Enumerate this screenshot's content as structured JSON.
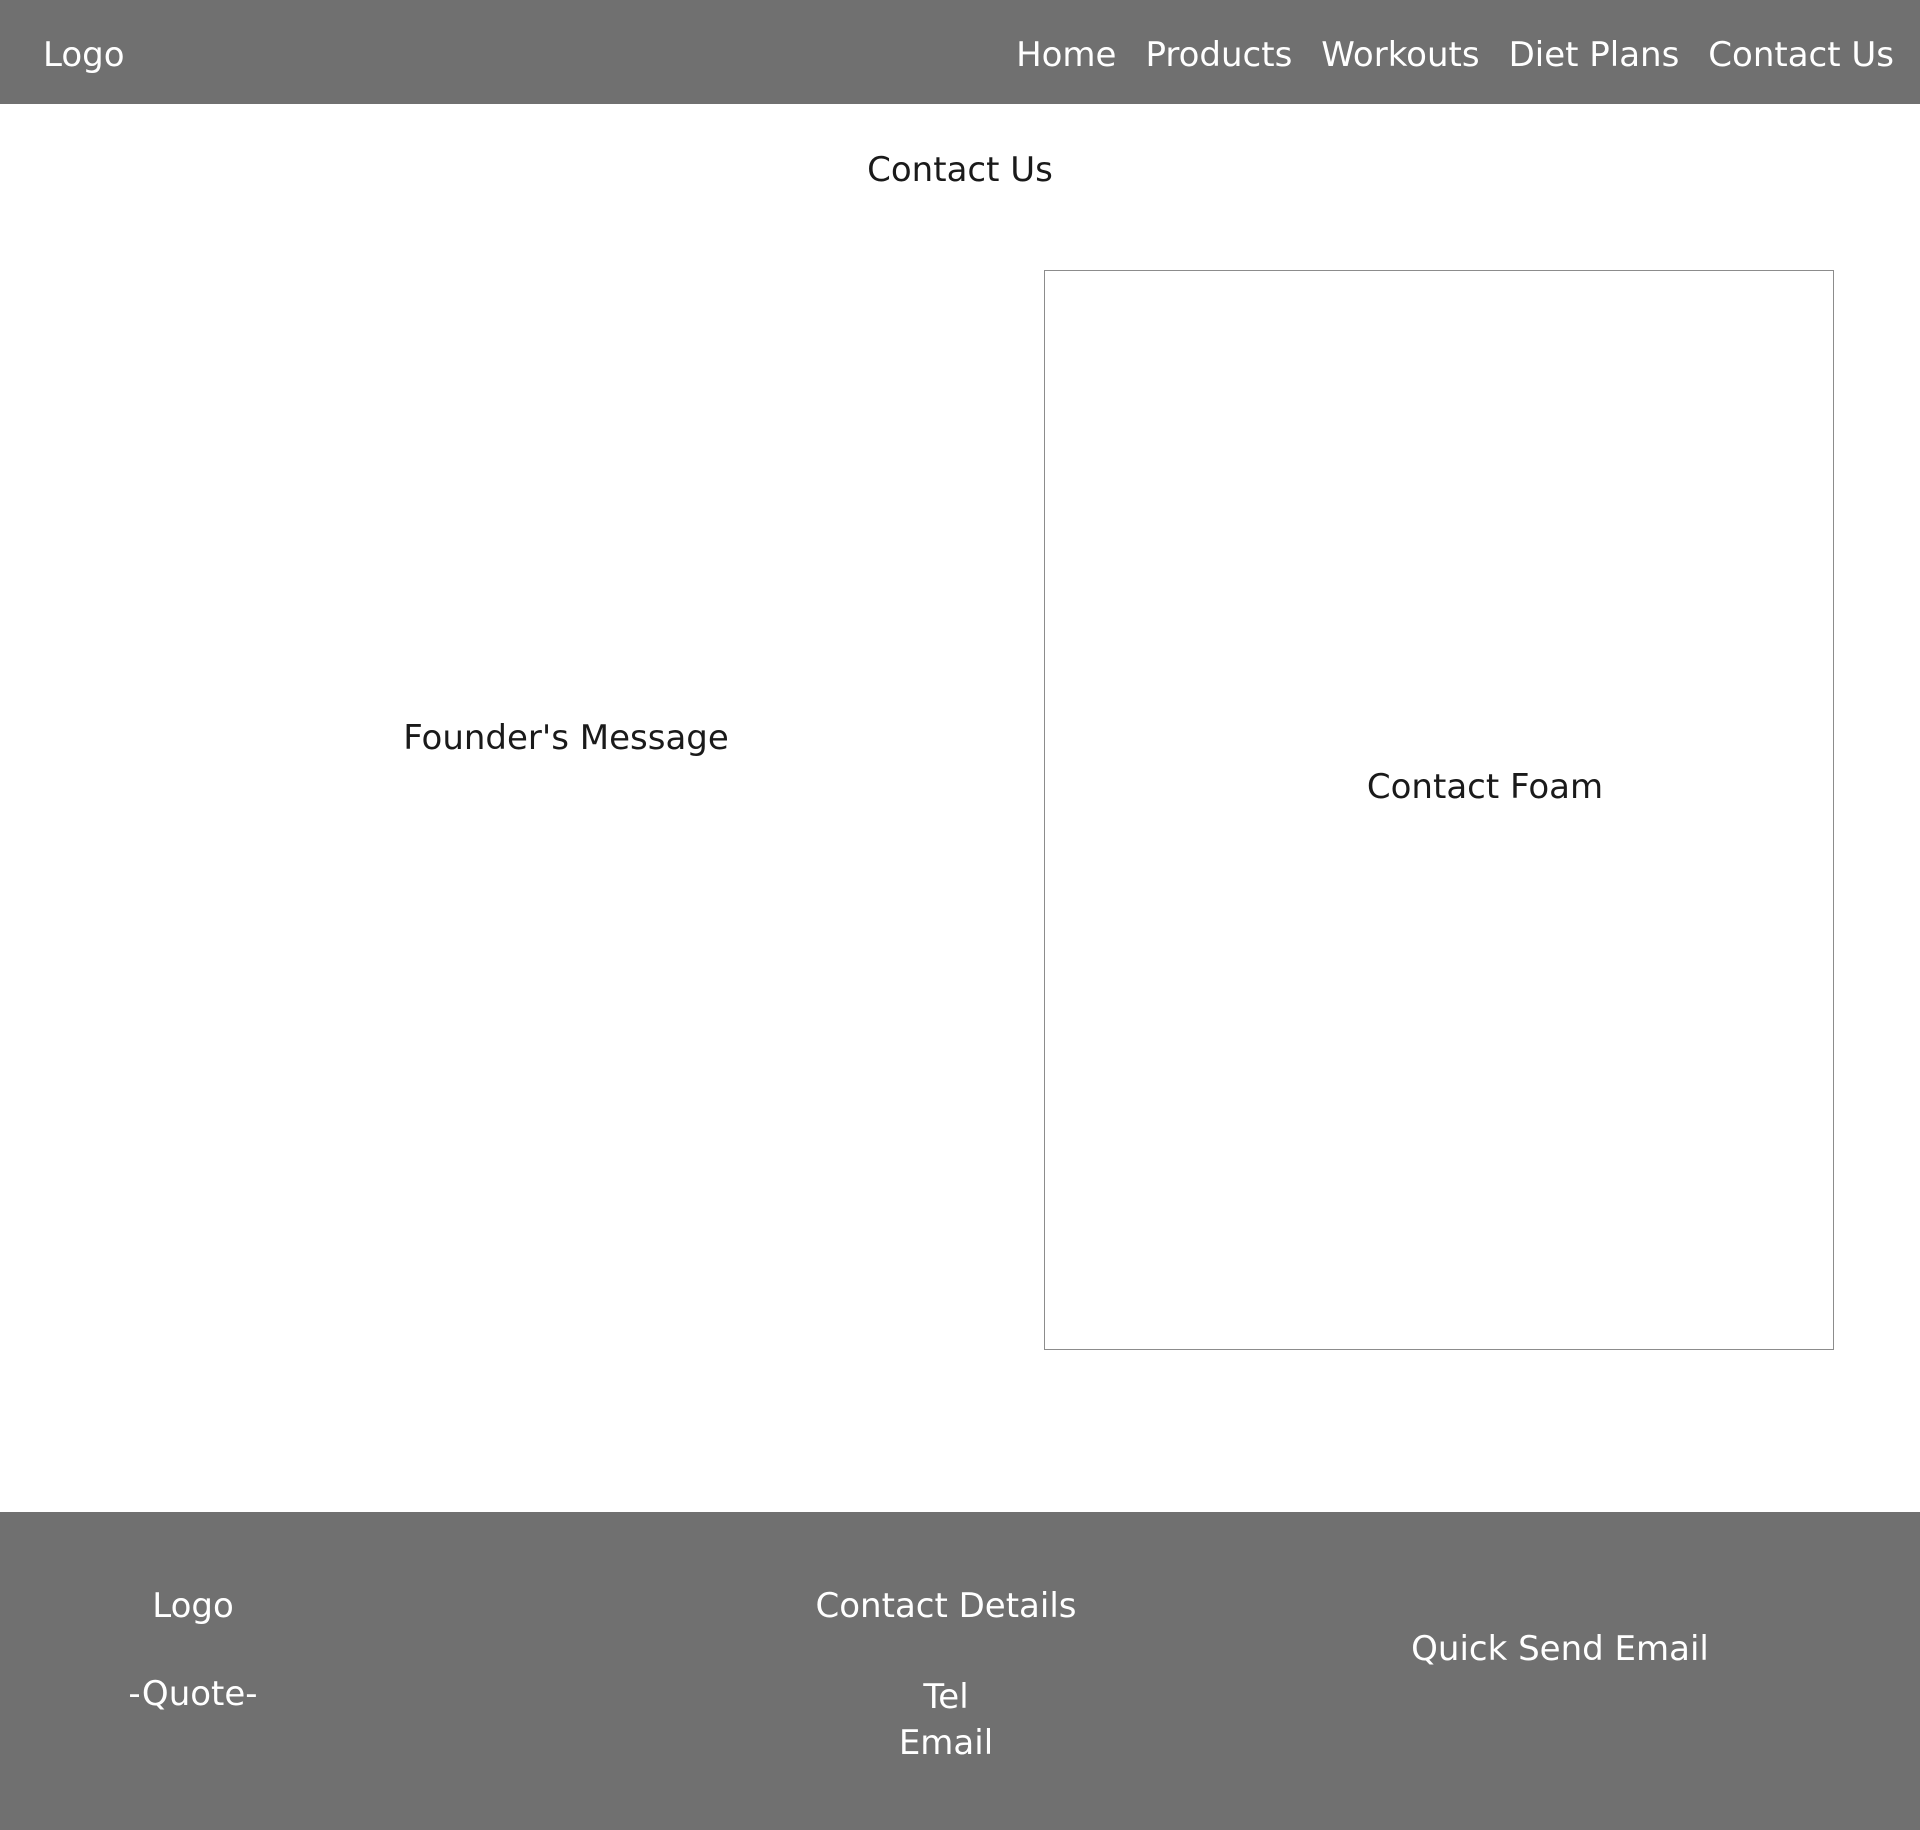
{
  "header": {
    "logo": "Logo",
    "nav": [
      "Home",
      "Products",
      "Workouts",
      "Diet Plans",
      "Contact Us"
    ]
  },
  "main": {
    "title": "Contact Us",
    "founder_message": "Founder's Message",
    "contact_form_label": "Contact Foam"
  },
  "footer": {
    "logo": "Logo",
    "quote": "-Quote-",
    "contact_details_title": "Contact Details",
    "tel": "Tel",
    "email": "Email",
    "quick_send": "Quick Send Email"
  },
  "colors": {
    "bar_background": "#707070",
    "bar_text": "#ffffff",
    "body_text": "#1a1a1a",
    "panel_border": "#8c8c8c"
  }
}
